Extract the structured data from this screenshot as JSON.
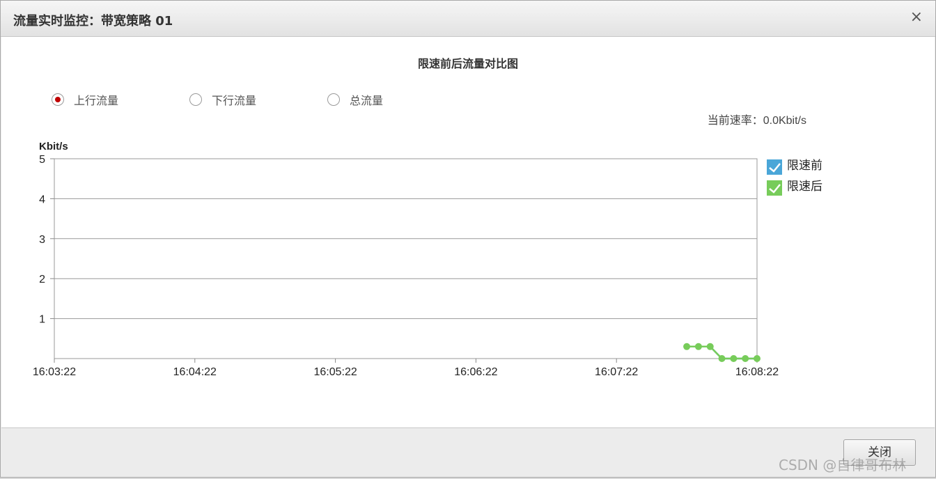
{
  "dialog": {
    "title": "流量实时监控：带宽策略 01",
    "close_glyph": "×",
    "close_button_label": "关闭"
  },
  "radios": [
    {
      "label": "上行流量",
      "checked": true
    },
    {
      "label": "下行流量",
      "checked": false
    },
    {
      "label": "总流量",
      "checked": false
    }
  ],
  "rate": {
    "label": "当前速率：",
    "value": "0.0Kbit/s"
  },
  "colors": {
    "series_before": "#4aa6d8",
    "series_after": "#77cc5a",
    "radio_selected": "#c00000"
  },
  "chart_data": {
    "type": "line",
    "title": "限速前后流量对比图",
    "ylabel": "Kbit/s",
    "xlabel": "",
    "ylim": [
      0,
      5
    ],
    "yticks": [
      "1",
      "2",
      "3",
      "4",
      "5"
    ],
    "x_range_seconds_labels": [
      "16:03:22",
      "16:04:22",
      "16:05:22",
      "16:06:22",
      "16:07:22",
      "16:08:22"
    ],
    "grid": true,
    "legend": "right",
    "series": [
      {
        "name": "限速前",
        "x": [
          "16:07:52",
          "16:07:57",
          "16:08:02",
          "16:08:07",
          "16:08:12",
          "16:08:17",
          "16:08:22"
        ],
        "y": [
          0.3,
          0.3,
          0.3,
          0.0,
          0.0,
          0.0,
          0.0
        ]
      },
      {
        "name": "限速后",
        "x": [
          "16:07:52",
          "16:07:57",
          "16:08:02",
          "16:08:07",
          "16:08:12",
          "16:08:17",
          "16:08:22"
        ],
        "y": [
          0.3,
          0.3,
          0.3,
          0.0,
          0.0,
          0.0,
          0.0
        ]
      }
    ]
  },
  "watermark": "CSDN @自律哥布林"
}
